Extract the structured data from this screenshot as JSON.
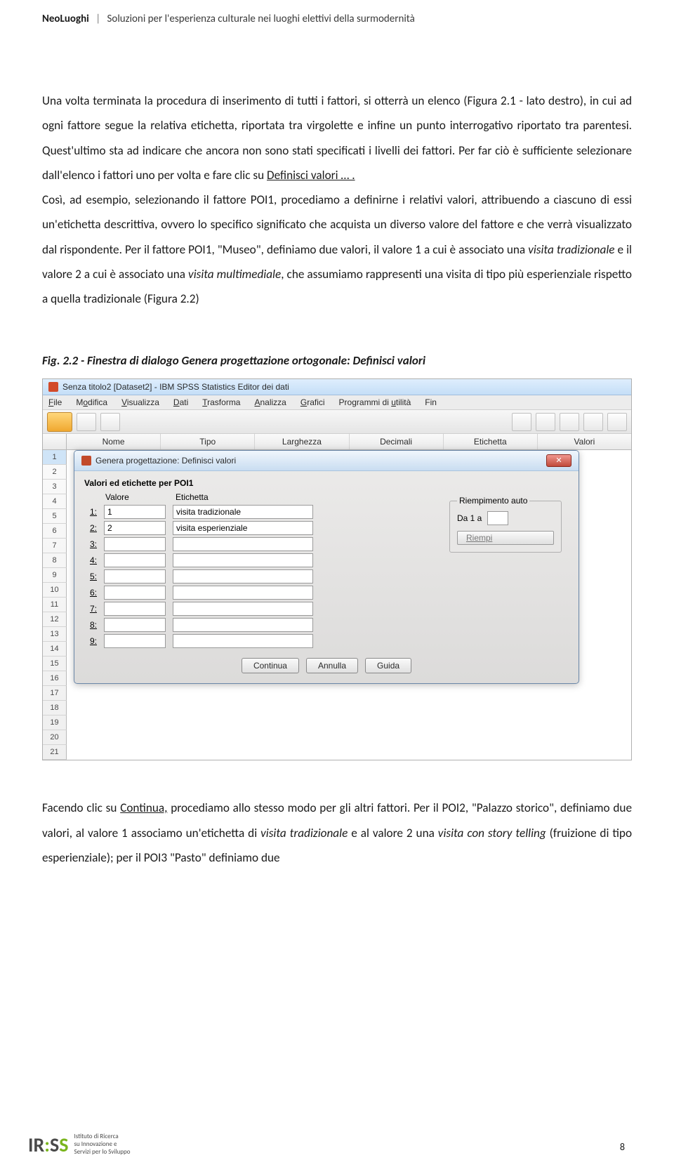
{
  "header": {
    "brand": "NeoLuoghi",
    "subtitle": "Soluzioni per l'esperienza culturale nei luoghi elettivi della surmodernità"
  },
  "para1": "Una volta terminata la procedura di inserimento di tutti i fattori, si otterrà un elenco (Figura 2.1 - lato destro), in cui ad ogni fattore segue la relativa etichetta, riportata tra virgolette e infine un punto interrogativo riportato tra parentesi. Quest'ultimo sta ad indicare che ancora non sono stati specificati i livelli dei fattori. Per far ciò è sufficiente selezionare dall'elenco i fattori uno per volta e fare clic su ",
  "para1_link": "Definisci valori … .",
  "para2_a": "Così, ad esempio, selezionando il fattore POI1, procediamo a definirne i relativi valori, attribuendo a ciascuno di essi un'etichetta descrittiva, ovvero lo specifico significato che acquista un diverso valore del fattore e che verrà visualizzato dal rispondente. Per il fattore POI1, \"Museo\", definiamo due valori, il valore 1 a cui è associato una ",
  "para2_i1": "visita tradizionale",
  "para2_b": " e il valore 2 a cui è associato una ",
  "para2_i2": "visita multimediale",
  "para2_c": ", che assumiamo rappresenti una visita di tipo più esperienziale rispetto a quella tradizionale (Figura 2.2)",
  "figcaption": "Fig. 2.2 - Finestra di dialogo Genera progettazione ortogonale: Definisci valori",
  "app": {
    "title": "Senza titolo2 [Dataset2] - IBM SPSS Statistics Editor dei dati",
    "menus": [
      "File",
      "Modifica",
      "Visualizza",
      "Dati",
      "Trasforma",
      "Analizza",
      "Grafici",
      "Programmi di utilità",
      "Fin"
    ],
    "cols": [
      "Nome",
      "Tipo",
      "Larghezza",
      "Decimali",
      "Etichetta",
      "Valori"
    ],
    "rows": [
      "1",
      "2",
      "3",
      "4",
      "5",
      "6",
      "7",
      "8",
      "9",
      "10",
      "11",
      "12",
      "13",
      "14",
      "15",
      "16",
      "17",
      "18",
      "19",
      "20",
      "21"
    ]
  },
  "dialog": {
    "title": "Genera progettazione: Definisci valori",
    "section": "Valori ed etichette per POI1",
    "valHdr": "Valore",
    "etiHdr": "Etichetta",
    "rows": [
      {
        "idx": "1:",
        "val": "1",
        "eti": "visita tradizionale"
      },
      {
        "idx": "2:",
        "val": "2",
        "eti": "visita esperienziale"
      },
      {
        "idx": "3:",
        "val": "",
        "eti": ""
      },
      {
        "idx": "4:",
        "val": "",
        "eti": ""
      },
      {
        "idx": "5:",
        "val": "",
        "eti": ""
      },
      {
        "idx": "6:",
        "val": "",
        "eti": ""
      },
      {
        "idx": "7:",
        "val": "",
        "eti": ""
      },
      {
        "idx": "8:",
        "val": "",
        "eti": ""
      },
      {
        "idx": "9:",
        "val": "",
        "eti": ""
      }
    ],
    "fill": {
      "legend": "Riempimento auto",
      "from": "Da 1 a",
      "btn": "Riempi"
    },
    "buttons": {
      "cont": "Continua",
      "cancel": "Annulla",
      "help": "Guida"
    }
  },
  "para3_a": "Facendo clic su ",
  "para3_link": "Continua,",
  "para3_b": " procediamo allo stesso modo per gli altri fattori. Per il POI2, \"Palazzo storico\", definiamo due valori, al valore 1 associamo un'etichetta di ",
  "para3_i1": "visita tradizionale",
  "para3_c": " e al valore 2 una ",
  "para3_i2": "visita con story telling",
  "para3_d": " (fruizione di tipo esperienziale); per il POI3 \"Pasto\" definiamo due",
  "pagenum": "8",
  "footer": {
    "logo": "IR:SS",
    "text1": "Istituto di Ricerca",
    "text2": "su Innovazione e",
    "text3": "Servizi per lo Sviluppo"
  }
}
